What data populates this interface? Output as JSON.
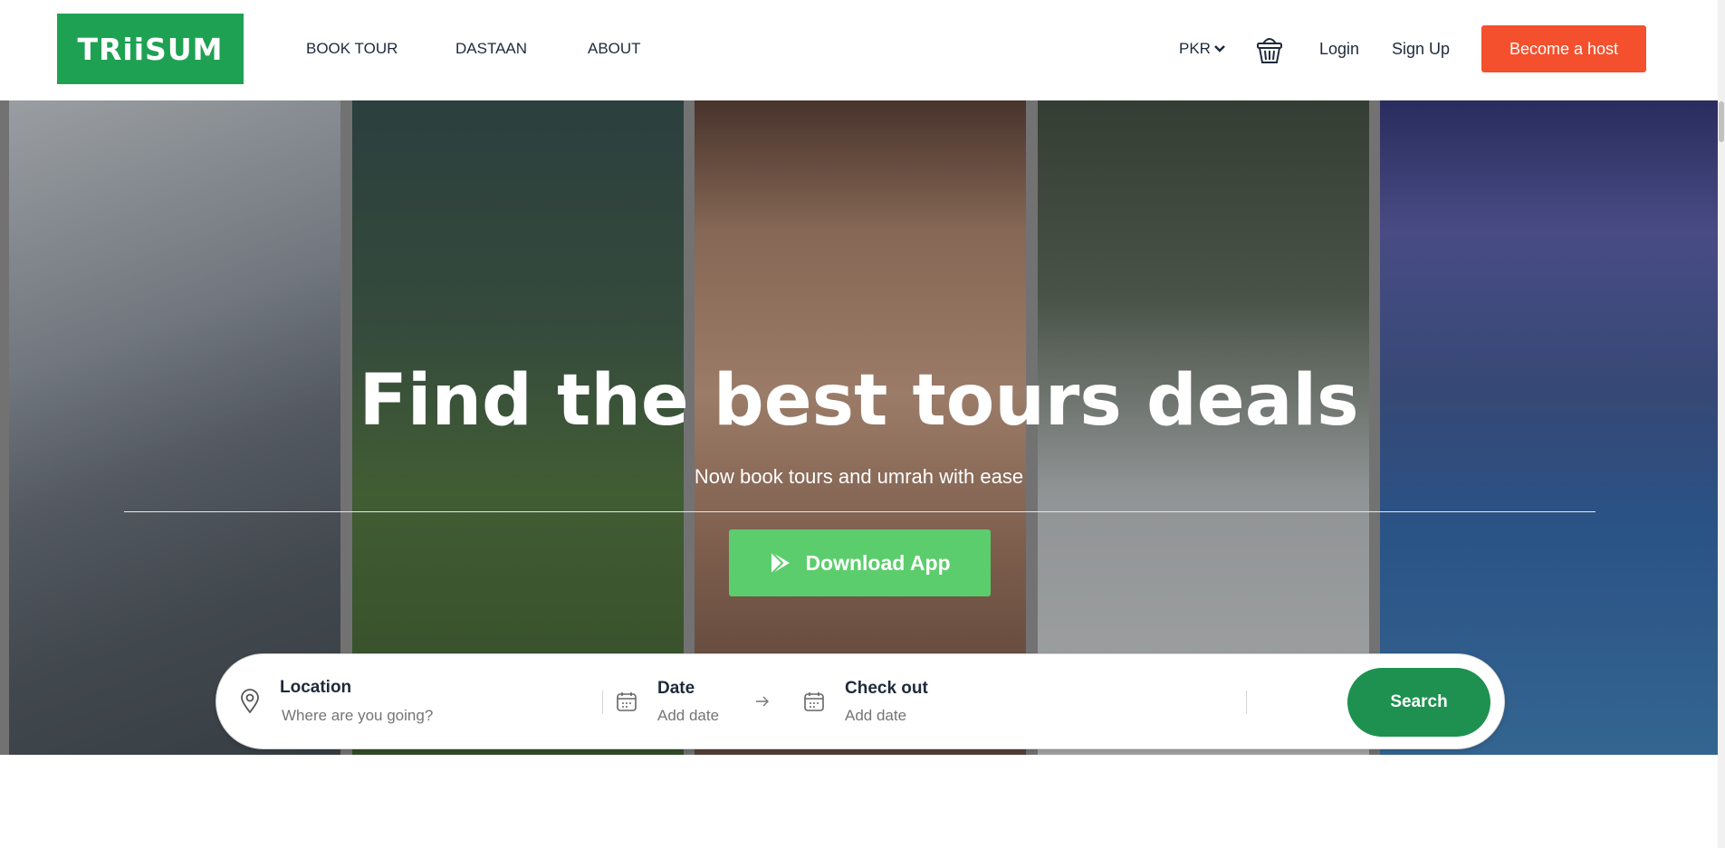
{
  "header": {
    "logo_text": "TRiiSUM",
    "nav": [
      "BOOK TOUR",
      "DASTAAN",
      "ABOUT"
    ],
    "currency": "PKR",
    "login": "Login",
    "signup": "Sign Up",
    "host_button": "Become a host",
    "colors": {
      "logo_bg": "#1fa153",
      "host_bg": "#f4502d"
    }
  },
  "hero": {
    "title": "Find the best tours deals",
    "subtitle": "Now book tours and umrah with ease",
    "download_button": "Download App",
    "download_icon": "play-store-icon",
    "download_color": "#5ccd6c"
  },
  "search": {
    "location_label": "Location",
    "location_placeholder": "Where are you going?",
    "date_label": "Date",
    "date_placeholder": "Add date",
    "checkout_label": "Check out",
    "checkout_placeholder": "Add date",
    "button": "Search",
    "button_color": "#1e9150",
    "icons": [
      "location-pin-icon",
      "calendar-icon",
      "arrow-right-icon",
      "calendar-icon"
    ]
  }
}
